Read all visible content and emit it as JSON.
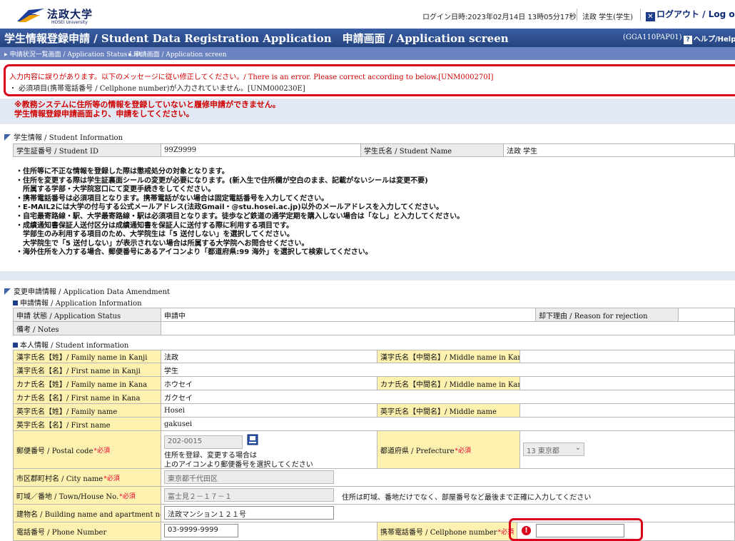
{
  "header": {
    "brand": "法政大学",
    "brand_sub": "HOSEI University",
    "login_time": "ログイン日時:2023年02月14日 13時05分17秒",
    "user": "法政 学生(学生)",
    "logout": "ログアウト / Log out",
    "logout_icon": "x-icon"
  },
  "titlebar": {
    "title": "学生情報登録申請 / Student Data Registration Application　申請画面 / Application screen",
    "screen_code": "(GGA110PAP01)",
    "help": "ヘルプ/Help",
    "help_icon": "?"
  },
  "breadcrumb": {
    "item1": "申請状況一覧画面 / Application Status List",
    "item2": "申請画面 / Application screen"
  },
  "errors": {
    "main": "入力内容に誤りがあります。以下のメッセージに従い修正してください。/ There is an error. Please correct according to below.[UNM000270I]",
    "detail": "・ 必須項目(携帯電話番号 / Cellphone number)が入力されていません。[UNM000230E]",
    "color": "#d9001b"
  },
  "warning": {
    "line1": "※教務システムに住所等の情報を登録していないと履修申請ができません。",
    "line2": "学生情報登録申請画面より、申請をしてください。"
  },
  "student_info": {
    "heading": "学生情報 / Student Information",
    "id_label": "学生証番号 / Student ID",
    "id_value": "99Z9999",
    "name_label": "学生氏名 / Student Name",
    "name_value": "法政 学生"
  },
  "notes": [
    "・住所等に不正な情報を登録した際は懲戒処分の対象となります。",
    "・住所を変更する際は学生証裏面シールの変更が必要になります。(新入生で住所欄が空白のまま、記載がないシールは変更不要)",
    "　所属する学部・大学院窓口にて変更手続きをしてください。",
    "・携帯電話番号は必須項目となります。携帯電話がない場合は固定電話番号を入力してください。",
    "・E-MAIL2には大学の付与する公式メールアドレス(法政Gmail・@stu.hosei.ac.jp)以外のメールアドレスを入力してください。",
    "・自宅最寄路線・駅、大学最寄路線・駅は必須項目となります。徒歩など鉄道の通学定期を購入しない場合は「なし」と入力してください。",
    "・成績通知書保証人送付区分は成績通知書を保証人に送付する際に利用する項目です。",
    "　学部生のみ利用する項目のため、大学院生は「5 送付しない」を選択してください。",
    "　大学院生で「5 送付しない」が表示されない場合は所属する大学院へお問合せください。",
    "・海外住所を入力する場合、郵便番号にあるアイコンより「都道府県:99 海外」を選択して検索してください。"
  ],
  "amendment": {
    "heading": "変更申請情報 / Application Data Amendment",
    "app_info_heading": "申請情報 / Application Information",
    "status_label": "申請 状態 / Application Status",
    "status_value": "申請中",
    "reject_label": "却下理由 / Reason for rejection",
    "notes_label": "備考 / Notes",
    "personal_heading": "本人情報 / Student information"
  },
  "form": {
    "family_kanji_label": "漢字氏名【姓】/ Family name in Kanji",
    "family_kanji": "法政",
    "middle_kanji_label": "漢字氏名【中間名】/ Middle name in Kanji",
    "first_kanji_label": "漢字氏名【名】/ First name in Kanji",
    "first_kanji": "学生",
    "family_kana_label": "カナ氏名【姓】/ Family name in Kana",
    "family_kana": "ホウセイ",
    "middle_kana_label": "カナ氏名【中間名】/ Middle name in Kana",
    "first_kana_label": "カナ氏名【名】/ First name in Kana",
    "first_kana": "ガクセイ",
    "family_en_label": "英字氏名【姓】/ Family name",
    "family_en": "Hosei",
    "middle_en_label": "英字氏名【中間名】/ Middle name",
    "first_en_label": "英字氏名【名】/ First name",
    "first_en": "gakusei",
    "postal_label": "郵便番号 / Postal code",
    "postal_value": "202-0015",
    "postal_hint1": "住所を登録、変更する場合は",
    "postal_hint2": "上のアイコンより郵便番号を選択してください",
    "postal_icon": "postal-search-icon",
    "prefecture_label": "都道府県 / Prefecture",
    "prefecture_value": "13 東京都",
    "city_label": "市区郡町村名 / City name",
    "city_value": "東京都千代田区",
    "town_label": "町域／番地 / Town/House No.",
    "town_value": "富士見２－１７－１",
    "town_hint": "住所は町域、番地だけでなく、部屋番号など最後まで正確に入力してください",
    "building_label": "建物名 / Building name and apartment no.",
    "building_value": "法政マンション１２１号",
    "phone_label": "電話番号 / Phone Number",
    "phone_value": "03-9999-9999",
    "cell_label": "携帯電話番号 / Cellphone number",
    "cell_value": "",
    "error_icon": "!",
    "required": "*必須"
  }
}
